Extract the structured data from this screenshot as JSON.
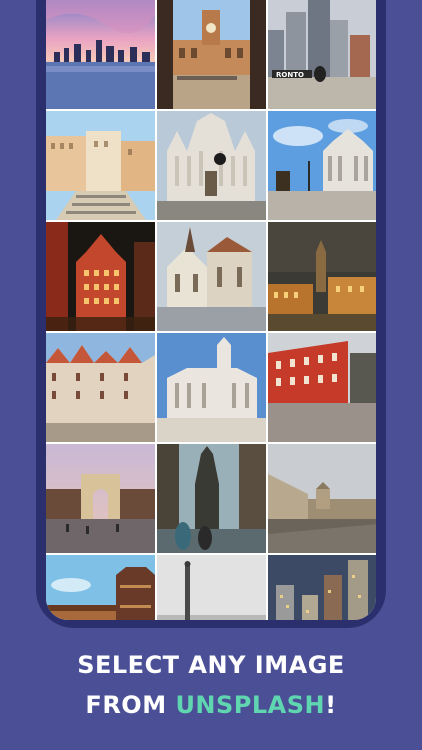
{
  "caption": {
    "line1": "SELECT ANY IMAGE",
    "line2_prefix": "FROM ",
    "line2_accent": "UNSPLASH",
    "line2_suffix": "!"
  },
  "colors": {
    "background": "#4a4f96",
    "phone_frame": "#2c2f6e",
    "accent": "#5fd6b0"
  },
  "gallery": {
    "tiles": [
      {
        "name": "photo-city-sunset-skyline"
      },
      {
        "name": "photo-clock-tower-square"
      },
      {
        "name": "photo-city-skyscrapers"
      },
      {
        "name": "photo-spanish-steps"
      },
      {
        "name": "photo-milan-cathedral"
      },
      {
        "name": "photo-parliament-building"
      },
      {
        "name": "photo-night-street"
      },
      {
        "name": "photo-gothic-church"
      },
      {
        "name": "photo-night-old-town"
      },
      {
        "name": "photo-timbered-houses"
      },
      {
        "name": "photo-baroque-cathedral"
      },
      {
        "name": "photo-red-building"
      },
      {
        "name": "photo-triumphal-arch"
      },
      {
        "name": "photo-gothic-spire-street"
      },
      {
        "name": "photo-palace-courtyard"
      },
      {
        "name": "photo-pagoda-building"
      },
      {
        "name": "photo-column-monument"
      },
      {
        "name": "photo-city-towers-dusk"
      }
    ]
  }
}
